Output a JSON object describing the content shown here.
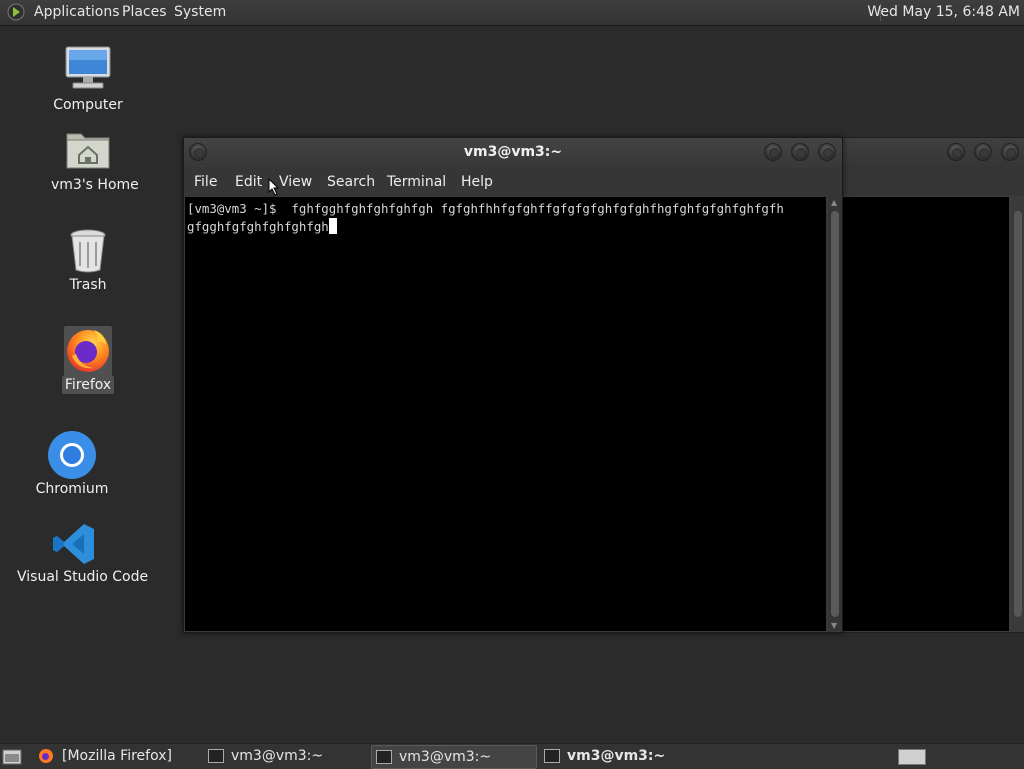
{
  "top_panel": {
    "menus": [
      "Applications",
      "Places",
      "System"
    ],
    "clock": "Wed May 15,  6:48 AM"
  },
  "desktop": {
    "icons": [
      {
        "label": "Computer",
        "icon": "computer-icon"
      },
      {
        "label": "vm3's Home",
        "icon": "home-folder-icon"
      },
      {
        "label": "Trash",
        "icon": "trash-icon"
      },
      {
        "label": "Firefox",
        "icon": "firefox-icon",
        "selected": true
      },
      {
        "label": "Chromium",
        "icon": "chromium-icon"
      },
      {
        "label": "Visual Studio Code",
        "icon": "vscode-icon"
      }
    ]
  },
  "terminal": {
    "title": "vm3@vm3:~",
    "menus": [
      "File",
      "Edit",
      "View",
      "Search",
      "Terminal",
      "Help"
    ],
    "lines": [
      "[vm3@vm3 ~]$  fghfgghfghfghfghfgh fgfghfhhfgfghffgfgfgfghfgfghfhgfghfgfghfghfgfh",
      "gfgghfgfghfghfghfgh"
    ]
  },
  "taskbar": {
    "tasks": [
      {
        "label": "[Mozilla Firefox]",
        "icon": "firefox-icon",
        "bold": false
      },
      {
        "label": "vm3@vm3:~",
        "icon": "terminal-icon",
        "bold": false
      },
      {
        "label": "vm3@vm3:~",
        "icon": "terminal-icon",
        "bold": false
      },
      {
        "label": "vm3@vm3:~",
        "icon": "terminal-icon",
        "bold": true
      }
    ]
  },
  "colors": {
    "desktop_bg": "#2b2b2b",
    "terminal_bg": "#000000",
    "panel_bg": "#333333",
    "vscode_blue": "#2d8fdc",
    "chromium_blue": "#3b8ee8"
  }
}
